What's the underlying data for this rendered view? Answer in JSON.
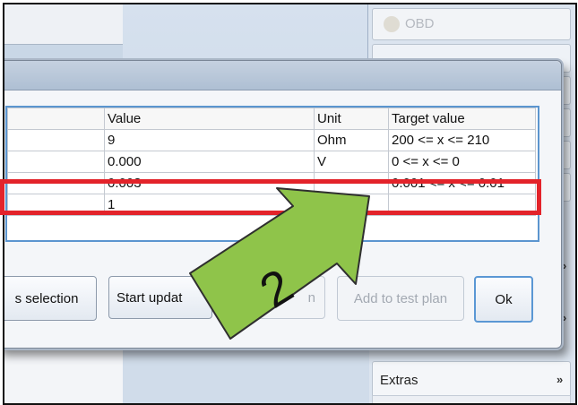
{
  "background": {
    "obd_label": "OBD",
    "extras_label": "Extras"
  },
  "table": {
    "headers": [
      "",
      "Value",
      "Unit",
      "Target value"
    ],
    "rows": [
      [
        "",
        "9",
        "Ohm",
        "200 <= x <= 210"
      ],
      [
        "",
        "0.000",
        "V",
        "0 <= x <= 0"
      ],
      [
        "",
        "0.003",
        "",
        "0.001 <= x <= 0.01"
      ],
      [
        "",
        "1",
        "",
        ""
      ]
    ],
    "highlighted_row": 2
  },
  "buttons": {
    "selection": "s selection",
    "start_update": "Start updat",
    "middle": "n",
    "add_to_test_plan": "Add to test plan",
    "ok": "Ok"
  },
  "annotation": {
    "step_number": "2",
    "arrow_color": "#8fc44a"
  },
  "colors": {
    "highlight": "#e3232a",
    "table_border": "#5b95cf"
  }
}
